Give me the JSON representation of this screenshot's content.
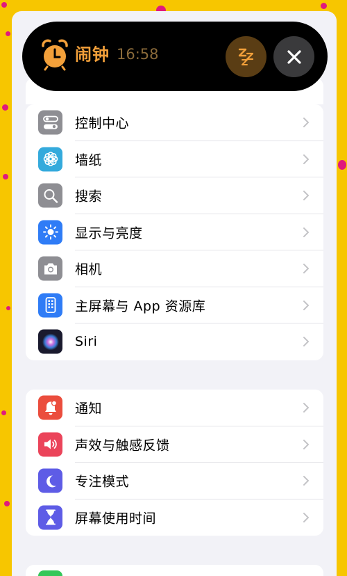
{
  "island": {
    "title": "闹钟",
    "time": "16:58",
    "snooze_icon": "zzz-icon",
    "close_icon": "close-icon",
    "accent": "#f3a03a"
  },
  "groups": [
    {
      "items": [
        {
          "label": "控制中心",
          "icon": "control-center-icon",
          "color": "#8e8e93"
        },
        {
          "label": "墙纸",
          "icon": "wallpaper-flower-icon",
          "color": "#34aadc"
        },
        {
          "label": "搜索",
          "icon": "search-icon",
          "color": "#8e8e93"
        },
        {
          "label": "显示与亮度",
          "icon": "brightness-sun-icon",
          "color": "#2f7cf6"
        },
        {
          "label": "相机",
          "icon": "camera-icon",
          "color": "#8e8e93"
        },
        {
          "label": "主屏幕与 App 资源库",
          "icon": "home-screen-icon",
          "color": "#2f7cf6"
        },
        {
          "label": "Siri",
          "icon": "siri-icon",
          "color": "#1a1a2e"
        }
      ]
    },
    {
      "items": [
        {
          "label": "通知",
          "icon": "notification-bell-icon",
          "color": "#eb4d3d"
        },
        {
          "label": "声效与触感反馈",
          "icon": "speaker-icon",
          "color": "#eb445a"
        },
        {
          "label": "专注模式",
          "icon": "moon-icon",
          "color": "#5e5ce6"
        },
        {
          "label": "屏幕使用时间",
          "icon": "hourglass-icon",
          "color": "#5e5ce6"
        }
      ]
    }
  ]
}
